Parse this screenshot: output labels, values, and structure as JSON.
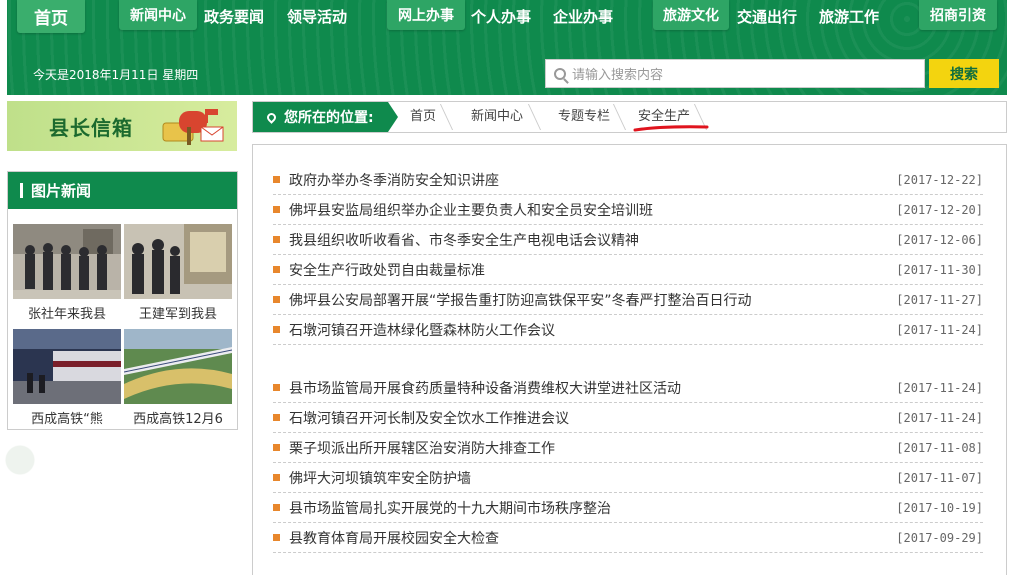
{
  "header": {
    "nav": {
      "home": "首页",
      "news_center": "新闻中心",
      "gov_news": "政务要闻",
      "leader_activity": "领导活动",
      "online_service": "网上办事",
      "personal_service": "个人办事",
      "enterprise_service": "企业办事",
      "tourism_culture": "旅游文化",
      "transport": "交通出行",
      "travel_work": "旅游工作",
      "investment": "招商引资"
    },
    "date_text": "今天是2018年1月11日 星期四",
    "search": {
      "placeholder": "请输入搜索内容",
      "button": "搜索"
    }
  },
  "colors": {
    "primary_green": "#0f8a4d",
    "accent_yellow": "#f3d40f",
    "bullet_orange": "#e8872c"
  },
  "sidebar": {
    "mailbox_title": "县长信箱",
    "pictures": {
      "title": "图片新闻",
      "items": [
        {
          "caption": "张社年来我县"
        },
        {
          "caption": "王建军到我县"
        },
        {
          "caption": "西成高铁“熊"
        },
        {
          "caption": "西成高铁12月6"
        }
      ]
    }
  },
  "breadcrumb": {
    "label": "您所在的位置:",
    "items": [
      "首页",
      "新闻中心",
      "专题专栏",
      "安全生产"
    ]
  },
  "articles": [
    {
      "title": "政府办举办冬季消防安全知识讲座",
      "date": "[2017-12-22]"
    },
    {
      "title": "佛坪县安监局组织举办企业主要负责人和安全员安全培训班",
      "date": "[2017-12-20]"
    },
    {
      "title": "我县组织收听收看省、市冬季安全生产电视电话会议精神",
      "date": "[2017-12-06]"
    },
    {
      "title": "安全生产行政处罚自由裁量标准",
      "date": "[2017-11-30]"
    },
    {
      "title": "佛坪县公安局部署开展“学报告重打防迎高铁保平安”冬春严打整治百日行动",
      "date": "[2017-11-27]"
    },
    {
      "title": "石墩河镇召开造林绿化暨森林防火工作会议",
      "date": "[2017-11-24]"
    },
    {
      "title": "县市场监管局开展食药质量特种设备消费维权大讲堂进社区活动",
      "date": "[2017-11-24]"
    },
    {
      "title": "石墩河镇召开河长制及安全饮水工作推进会议",
      "date": "[2017-11-24]"
    },
    {
      "title": "栗子坝派出所开展辖区治安消防大排查工作",
      "date": "[2017-11-08]"
    },
    {
      "title": "佛坪大河坝镇筑牢安全防护墙",
      "date": "[2017-11-07]"
    },
    {
      "title": "县市场监管局扎实开展党的十九大期间市场秩序整治",
      "date": "[2017-10-19]"
    },
    {
      "title": "县教育体育局开展校园安全大检查",
      "date": "[2017-09-29]"
    }
  ]
}
